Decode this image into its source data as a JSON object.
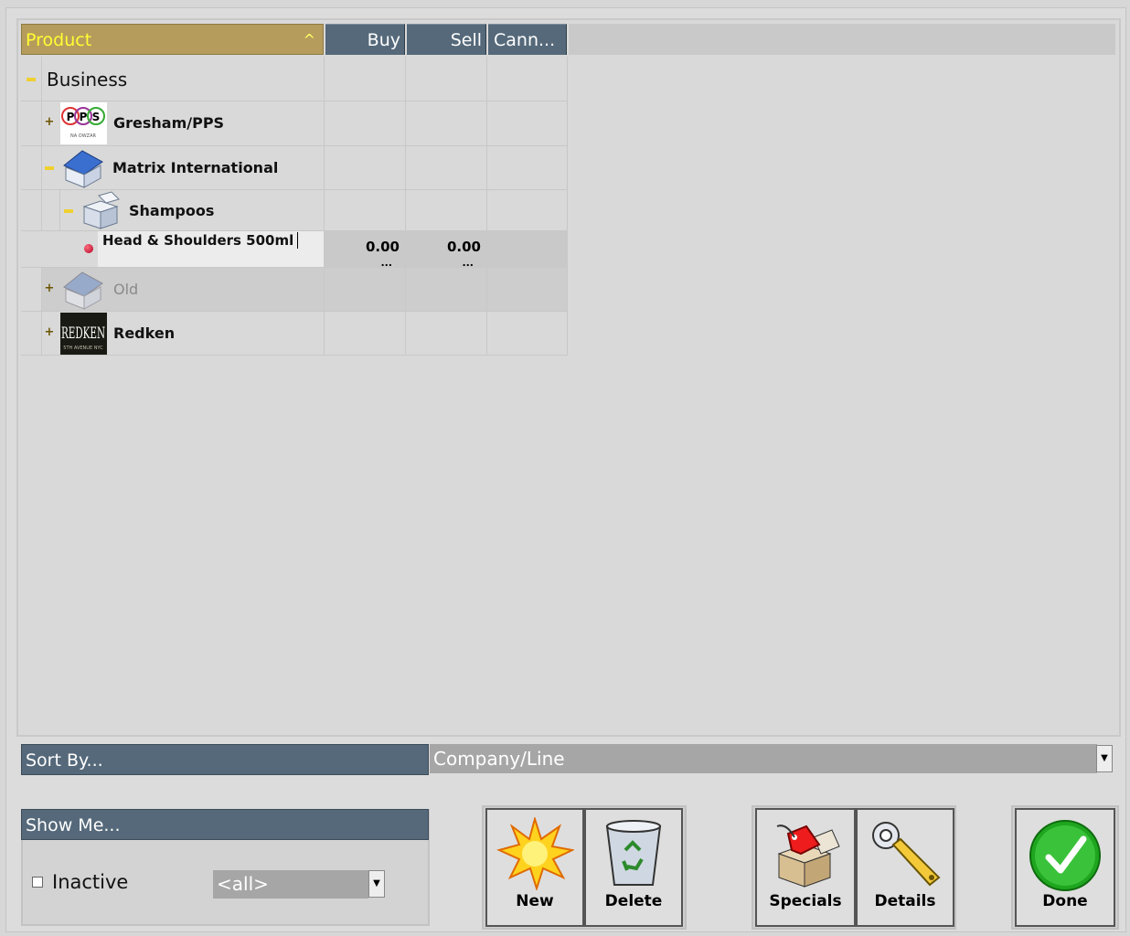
{
  "header": {
    "product": "Product",
    "sort_indicator": "^",
    "buy": "Buy",
    "sell": "Sell",
    "cann": "Cann..."
  },
  "tree": {
    "business": {
      "label": "Business",
      "toggle": "−"
    },
    "gresham": {
      "label": "Gresham/PPS",
      "toggle": "+",
      "logo_text": "PPS",
      "logo_sub": "NA OWZAR"
    },
    "matrix": {
      "label": "Matrix International",
      "toggle": "−"
    },
    "shampoos": {
      "label": "Shampoos",
      "toggle": "−"
    },
    "product_row": {
      "label": "Head & Shoulders 500ml",
      "buy": "0.00",
      "sell": "0.00",
      "ellipsis": "..."
    },
    "old": {
      "label": "Old",
      "toggle": "+"
    },
    "redken": {
      "label": "Redken",
      "toggle": "+",
      "logo_text": "REDKEN",
      "logo_sub": "5TH AVENUE NYC"
    }
  },
  "sort_by": {
    "label": "Sort By...",
    "value": "Company/Line"
  },
  "show_me": {
    "label": "Show Me...",
    "inactive_label": "Inactive",
    "filter_value": "<all>",
    "inactive_checked": false
  },
  "buttons": {
    "new": "New",
    "delete": "Delete",
    "specials": "Specials",
    "details": "Details",
    "done": "Done"
  },
  "colors": {
    "header_bar": "#55697a",
    "product_header": "#b59c5c",
    "product_header_text": "#ffff33",
    "background": "#d7d7d7"
  }
}
